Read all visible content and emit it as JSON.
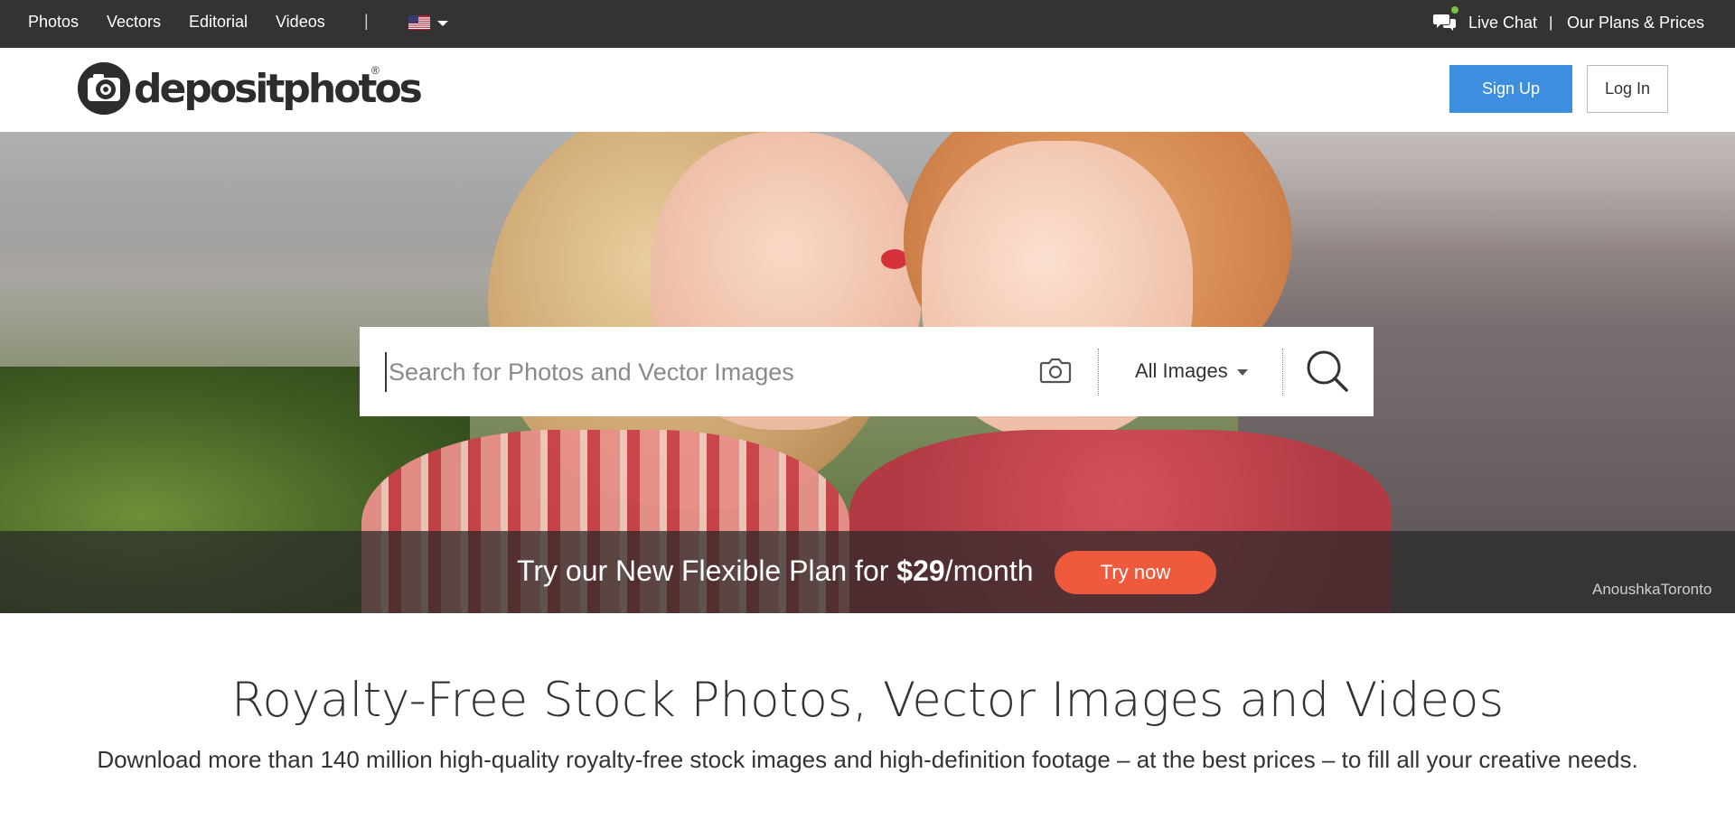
{
  "topbar": {
    "nav": [
      "Photos",
      "Vectors",
      "Editorial",
      "Videos"
    ],
    "separator": "|",
    "live_chat": "Live Chat",
    "pipe": "|",
    "plans": "Our Plans & Prices"
  },
  "header": {
    "logo_text": "depositphotos",
    "logo_reg": "®",
    "signup": "Sign Up",
    "login": "Log In"
  },
  "search": {
    "placeholder": "Search for Photos and Vector Images",
    "category": "All Images"
  },
  "promo": {
    "text_prefix": "Try our New Flexible Plan for ",
    "price": "$29",
    "text_suffix": "/month",
    "button": "Try now"
  },
  "hero": {
    "credit": "AnoushkaToronto"
  },
  "main": {
    "title": "Royalty-Free Stock Photos, Vector Images and Videos",
    "subtitle": "Download more than 140 million high-quality royalty-free stock images and high-definition footage – at the best prices – to fill all your creative needs."
  },
  "colors": {
    "topbar": "#333333",
    "signup": "#3d8de0",
    "try_now": "#f05a3c",
    "chat_dot": "#7bc142"
  }
}
